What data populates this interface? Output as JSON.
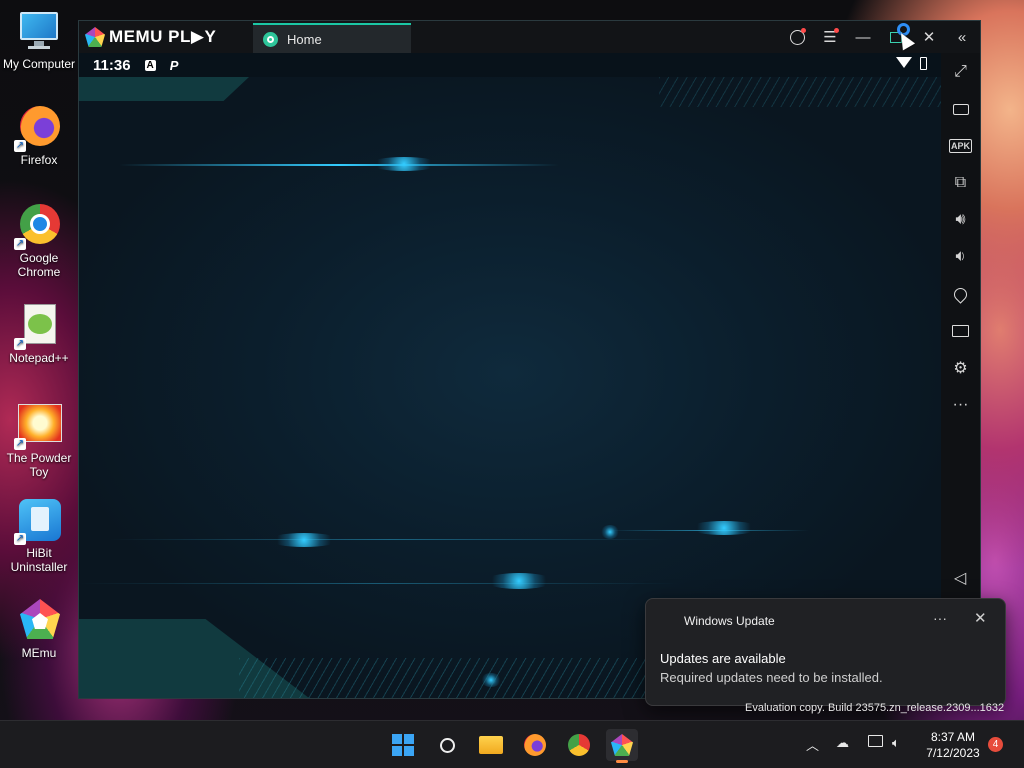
{
  "desktop": {
    "icons": [
      {
        "label": "My Computer",
        "icon": "monitor-icon"
      },
      {
        "label": "Firefox",
        "icon": "firefox-icon"
      },
      {
        "label": "Google Chrome",
        "icon": "chrome-icon"
      },
      {
        "label": "Notepad++",
        "icon": "notepadpp-icon"
      },
      {
        "label": "The Powder Toy",
        "icon": "powder-toy-icon"
      },
      {
        "label": "HiBit Uninstaller",
        "icon": "hibit-icon"
      },
      {
        "label": "MEmu",
        "icon": "memu-icon"
      }
    ]
  },
  "memu": {
    "logo_text": "MEMU PL▶Y",
    "tab_label": "Home",
    "status_time": "11:36",
    "status_icons": [
      "A",
      "P"
    ],
    "side_toolbar": [
      "fullscreen",
      "keyboard",
      "apk",
      "multi-instance",
      "volume-up",
      "volume-down",
      "location",
      "folder",
      "settings",
      "more",
      "back"
    ],
    "side_labels": {
      "apk": "APK"
    }
  },
  "notification": {
    "app_name": "Windows Update",
    "title": "Updates are available",
    "body": "Required updates need to be installed.",
    "more_label": "···",
    "close_label": "✕"
  },
  "watermark": "Evaluation copy. Build 23575.zn_release.2309...1632",
  "taskbar": {
    "apps": [
      "start",
      "search",
      "file-explorer",
      "firefox",
      "chrome",
      "memu"
    ],
    "time": "8:37 AM",
    "date": "7/12/2023",
    "notification_count": "4"
  }
}
